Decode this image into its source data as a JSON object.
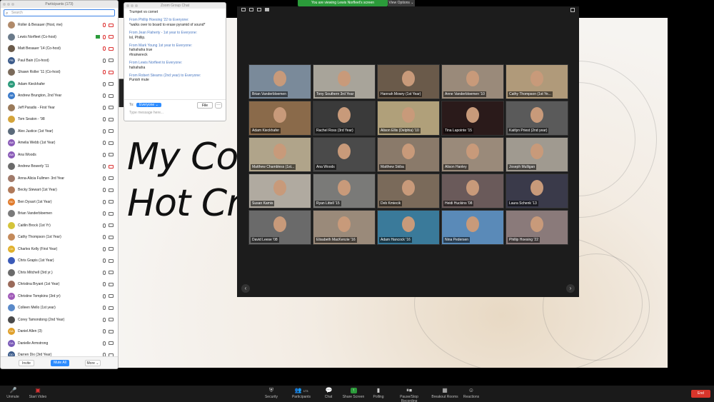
{
  "banner": {
    "text": "You are viewing Lewis Norfleet's screen",
    "view_options": "View Options ⌄"
  },
  "slide": {
    "line1": "My Cou",
    "line2": "Hot Cro"
  },
  "participants": {
    "title": "Participants (173)",
    "search_placeholder": "Search",
    "items": [
      {
        "name": "Roller & Besauer (Host, me)",
        "initials": "",
        "color": "#b08a6a",
        "mic": "muted",
        "cam": "off"
      },
      {
        "name": "Lewis Norfleet (Co-host)",
        "initials": "",
        "color": "#6a7a8a",
        "mic": "muted",
        "cam": "off",
        "share": true
      },
      {
        "name": "Matt Besauer '14 (Co-host)",
        "initials": "",
        "color": "#6a5a4a",
        "mic": "muted",
        "cam": "off"
      },
      {
        "name": "Paul Bain (Co-host)",
        "initials": "PB",
        "color": "#3a5a8a",
        "mic": "on",
        "cam": "on"
      },
      {
        "name": "Shawn Roller '11 (Co-host)",
        "initials": "",
        "color": "#7a6a5a",
        "mic": "muted",
        "cam": "off"
      },
      {
        "name": "Adam Kieckhafer",
        "initials": "AK",
        "color": "#2a9a7a",
        "mic": "on",
        "cam": "on"
      },
      {
        "name": "Andrew Brungton, 2nd Year",
        "initials": "AB",
        "color": "#3a7ac9",
        "mic": "on",
        "cam": "on"
      },
      {
        "name": "Jeff Paradis - First Year",
        "initials": "",
        "color": "#9a7a5a",
        "mic": "on",
        "cam": "on"
      },
      {
        "name": "Tom Seaton - '98",
        "initials": "",
        "color": "#d4a43a",
        "mic": "on",
        "cam": "on"
      },
      {
        "name": "Alex Justice (1st Year)",
        "initials": "",
        "color": "#5a6a7a",
        "mic": "on",
        "cam": "on"
      },
      {
        "name": "Amelia Webb (1st Year)",
        "initials": "AW",
        "color": "#8a5ab8",
        "mic": "on",
        "cam": "on"
      },
      {
        "name": "Ana Woods",
        "initials": "AW",
        "color": "#8a5ab8",
        "mic": "on",
        "cam": "on"
      },
      {
        "name": "Andrew Bowerly '11",
        "initials": "",
        "color": "#6a6a6a",
        "mic": "on",
        "cam": "off"
      },
      {
        "name": "Anna-Alicia Fullmer- 3rd Year",
        "initials": "",
        "color": "#a07a6a",
        "mic": "on",
        "cam": "on"
      },
      {
        "name": "Becky Stewart (1st Year)",
        "initials": "",
        "color": "#b07a5a",
        "mic": "on",
        "cam": "on"
      },
      {
        "name": "Ben Dysart (1st Year)",
        "initials": "BD",
        "color": "#e07a2a",
        "mic": "on",
        "cam": "on"
      },
      {
        "name": "Brian Vanderbloemen",
        "initials": "",
        "color": "#7a7a7a",
        "mic": "on",
        "cam": "on"
      },
      {
        "name": "Caitlin Brock (1st Yr)",
        "initials": "",
        "color": "#d4c43a",
        "mic": "on",
        "cam": "on"
      },
      {
        "name": "Cathy Thompson (1st Year)",
        "initials": "",
        "color": "#c48a5a",
        "mic": "on",
        "cam": "on"
      },
      {
        "name": "Charles Kelly (First Year)",
        "initials": "CK",
        "color": "#e0b02a",
        "mic": "on",
        "cam": "on"
      },
      {
        "name": "Chris Grapis (1st Year)",
        "initials": "",
        "color": "#3a5ab8",
        "mic": "on",
        "cam": "on"
      },
      {
        "name": "Chris Mitchell (3rd yr.)",
        "initials": "",
        "color": "#6a6a6a",
        "mic": "on",
        "cam": "on"
      },
      {
        "name": "Christina Bryant (1st Year)",
        "initials": "",
        "color": "#9a6a5a",
        "mic": "on",
        "cam": "on"
      },
      {
        "name": "Christine Tompkins (3rd yr)",
        "initials": "CT",
        "color": "#a05ab8",
        "mic": "on",
        "cam": "on"
      },
      {
        "name": "Colleen Mello (1st year)",
        "initials": "",
        "color": "#5a8ac9",
        "mic": "on",
        "cam": "on"
      },
      {
        "name": "Corey Tamondong (2nd Year)",
        "initials": "",
        "color": "#4a4a4a",
        "mic": "on",
        "cam": "on"
      },
      {
        "name": "Daniel Allen (3)",
        "initials": "DA",
        "color": "#e0a02a",
        "mic": "on",
        "cam": "on"
      },
      {
        "name": "Danielle Armstrong",
        "initials": "DA",
        "color": "#7a5ab8",
        "mic": "on",
        "cam": "on"
      },
      {
        "name": "Darren Dix (3rd Year)",
        "initials": "DD",
        "color": "#3a5a8a",
        "mic": "on",
        "cam": "on"
      }
    ],
    "invite": "Invite",
    "mute_all": "Mute All",
    "more": "More ⌄"
  },
  "chat": {
    "title": "Zoom Group Chat",
    "messages": [
      {
        "from": "",
        "text": "Trumpet vs cornet"
      },
      {
        "from": "From Phillip Hoesing '22 to Everyone:",
        "text": "*walks over to board to erase pyramid of sound*"
      },
      {
        "from": "From Jean Flaherty - 1st year to Everyone:",
        "text": "lol, Phillip."
      },
      {
        "from": "From Mark Young 1st year to Everyone:",
        "text": "hahahaha true\n#trainwreck"
      },
      {
        "from": "From Lewis Norfleet to Everyone:",
        "text": "hahahaha"
      },
      {
        "from": "From Robert Stearns (2nd year) to Everyone:",
        "text": "Punish mute"
      }
    ],
    "to_label": "To:",
    "to_value": "Everyone ⌄",
    "file": "File",
    "more": "···",
    "input_placeholder": "Type message here..."
  },
  "gallery": {
    "tiles": [
      {
        "name": "Brian Vanderbloemen",
        "bg": "#7a8a9a"
      },
      {
        "name": "Tony Southern 3rd Year",
        "bg": "#a8a49a"
      },
      {
        "name": "Hannah Mowry (1st Year)",
        "bg": "#6a5a4a"
      },
      {
        "name": "Anne Vanderbloemen '10",
        "bg": "#9a8a7a"
      },
      {
        "name": "Cathy Thompson (1st Ye...",
        "bg": "#b09a7a"
      },
      {
        "name": "Adam Kieckhafer",
        "bg": "#8a6a4a"
      },
      {
        "name": "Rachel Ross (3rd Year)",
        "bg": "#3a3a3a"
      },
      {
        "name": "Alison Ellis (Delphia) '10",
        "bg": "#b0a07a"
      },
      {
        "name": "Tina Lapointe '15",
        "bg": "#2a1a1a"
      },
      {
        "name": "Kaitlyn Priest (2nd year)",
        "bg": "#5a5a5a"
      },
      {
        "name": "Matthew Chambless (1st...",
        "bg": "#b0a48a"
      },
      {
        "name": "Ana Woods",
        "bg": "#4a4a4a"
      },
      {
        "name": "Matthew Skiba",
        "bg": "#8a7a6a"
      },
      {
        "name": "Alison Hanley",
        "bg": "#9a8a7a"
      },
      {
        "name": "Joseph Mulligan",
        "bg": "#a09a90"
      },
      {
        "name": "Susan Kamis",
        "bg": "#b0aaa0"
      },
      {
        "name": "Ryan Littell '15",
        "bg": "#7a7a78"
      },
      {
        "name": "Deb Kmiecik",
        "bg": "#7a6a5a"
      },
      {
        "name": "Heidi Huckins '08",
        "bg": "#6a5a5a"
      },
      {
        "name": "Laura Schenk '13",
        "bg": "#3a3a4a"
      },
      {
        "name": "David Leese '08",
        "bg": "#6a6a6a"
      },
      {
        "name": "Elisabeth MacKenzie '16",
        "bg": "#9a8a7a"
      },
      {
        "name": "Adam Hancock '16",
        "bg": "#3a7a9a"
      },
      {
        "name": "Nina Pedersen",
        "bg": "#5a8ab8"
      },
      {
        "name": "Phillip Hoesing '22",
        "bg": "#8a7a7a"
      }
    ]
  },
  "toolbar": {
    "unmute": "Unmute",
    "start_video": "Start Video",
    "security": "Security",
    "participants": "Participants",
    "participants_count": "173",
    "chat": "Chat",
    "share_screen": "Share Screen",
    "polling": "Polling",
    "recording": "Pause/Stop Recording",
    "breakout": "Breakout Rooms",
    "reactions": "Reactions",
    "end": "End"
  }
}
